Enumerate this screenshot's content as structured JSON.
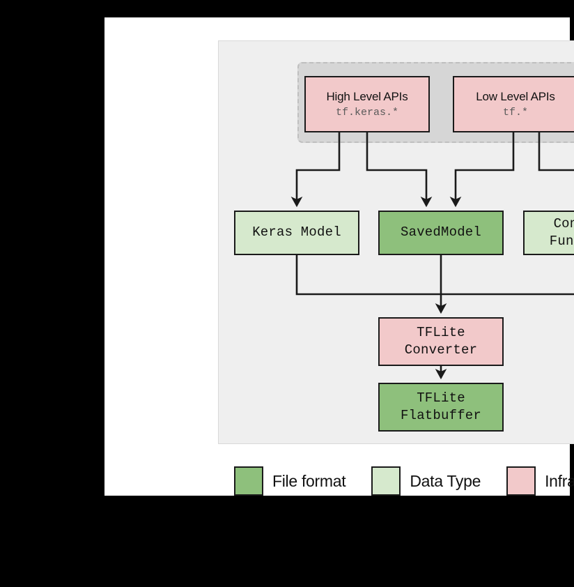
{
  "diagram": {
    "api_group": {
      "name": "api-group",
      "nodes": [
        {
          "id": "high-level-apis",
          "title": "High Level APIs",
          "subtitle": "tf.keras.*",
          "category": "Infrastructure",
          "color": "#f2c9ca"
        },
        {
          "id": "low-level-apis",
          "title": "Low Level APIs",
          "subtitle": "tf.*",
          "category": "Infrastructure",
          "color": "#f2c9ca"
        }
      ]
    },
    "model_row": [
      {
        "id": "keras-model",
        "title": "Keras Model",
        "category": "Data Type",
        "color": "#d6e9cd"
      },
      {
        "id": "saved-model",
        "title": "SavedModel",
        "category": "File format",
        "color": "#8ec07c"
      },
      {
        "id": "concrete-functions",
        "title": "Concrete\nFunctions",
        "category": "Data Type",
        "color": "#d6e9cd"
      }
    ],
    "converter_chain": [
      {
        "id": "tflite-converter",
        "title": "TFLite\nConverter",
        "category": "Infrastructure",
        "color": "#f2c9ca"
      },
      {
        "id": "tflite-flatbuffer",
        "title": "TFLite\nFlatbuffer",
        "category": "File format",
        "color": "#8ec07c"
      }
    ],
    "legend": {
      "items": [
        {
          "label": "File format",
          "color": "#8ec07c"
        },
        {
          "label": "Data Type",
          "color": "#d6e9cd"
        },
        {
          "label": "Infrastructure",
          "color": "#f2c9ca"
        }
      ]
    },
    "edges": [
      {
        "from": "high-level-apis",
        "to": "keras-model"
      },
      {
        "from": "high-level-apis",
        "to": "saved-model"
      },
      {
        "from": "low-level-apis",
        "to": "saved-model"
      },
      {
        "from": "low-level-apis",
        "to": "concrete-functions"
      },
      {
        "from": "keras-model",
        "to": "tflite-converter"
      },
      {
        "from": "saved-model",
        "to": "tflite-converter"
      },
      {
        "from": "concrete-functions",
        "to": "tflite-converter"
      },
      {
        "from": "tflite-converter",
        "to": "tflite-flatbuffer"
      }
    ]
  }
}
